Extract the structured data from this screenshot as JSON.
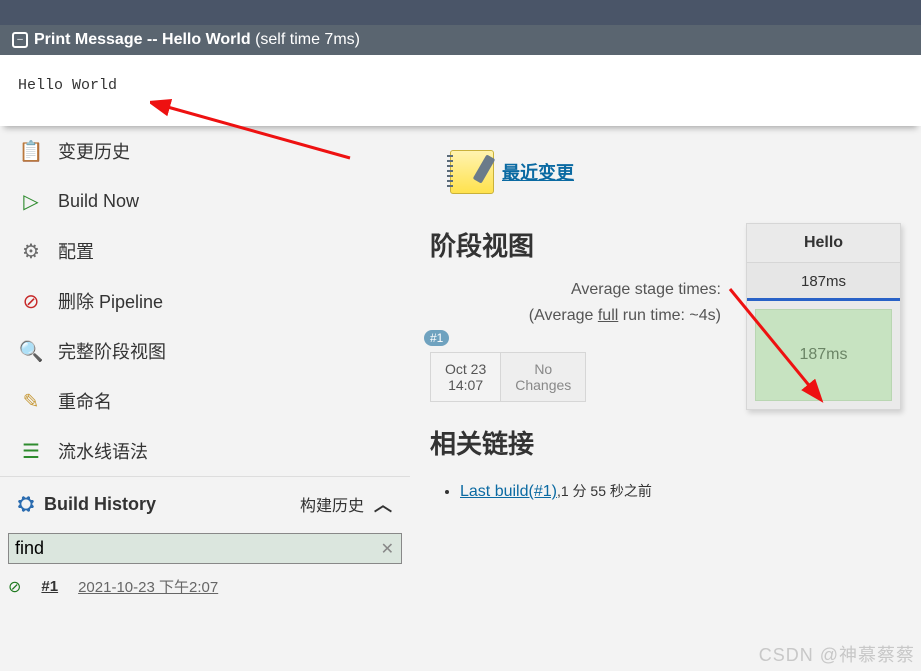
{
  "header": {
    "title_bold": "Print Message -- Hello World",
    "title_time": "(self time 7ms)"
  },
  "output": {
    "text": "Hello World"
  },
  "sidebar": {
    "items": [
      {
        "icon": "📋",
        "label": "变更历史",
        "cls": "ic-clock"
      },
      {
        "icon": "▷",
        "label": "Build Now",
        "cls": "ic-play"
      },
      {
        "icon": "⚙",
        "label": "配置",
        "cls": "ic-gear"
      },
      {
        "icon": "⊘",
        "label": "删除 Pipeline",
        "cls": "ic-no"
      },
      {
        "icon": "🔍",
        "label": "完整阶段视图",
        "cls": "ic-mag"
      },
      {
        "icon": "✎",
        "label": "重命名",
        "cls": "ic-edit"
      },
      {
        "icon": "☰",
        "label": "流水线语法",
        "cls": "ic-doc"
      }
    ],
    "build_history": {
      "title": "Build History",
      "subtitle": "构建历史",
      "find_value": "find",
      "row": {
        "num": "#1",
        "ts": "2021-10-23 下午2:07"
      }
    }
  },
  "content": {
    "recent_changes": "最近变更",
    "stage_title": "阶段视图",
    "avg1_prefix": "Average stage times:",
    "avg2_prefix": "(Average ",
    "avg2_underline": "full",
    "avg2_suffix": " run time: ~4s)",
    "stage": {
      "name": "Hello",
      "time": "187ms",
      "big_time": "187ms"
    },
    "cell": {
      "badge": "#1",
      "date": "Oct 23",
      "time": "14:07",
      "nc1": "No",
      "nc2": "Changes"
    },
    "links_title": "相关链接",
    "perma": {
      "link": "Last build(#1)",
      "suffix": ",1 分 55 秒之前"
    }
  },
  "watermark": "CSDN @神慕蔡蔡"
}
